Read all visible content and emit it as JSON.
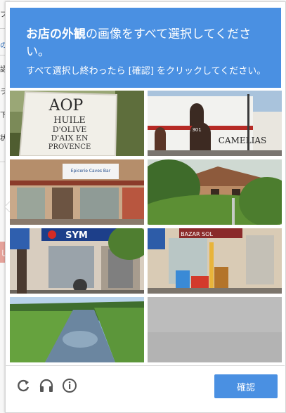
{
  "background_page": {
    "chars": [
      "フ",
      "の",
      "認",
      "ラ",
      "下",
      "状"
    ],
    "badge": "し"
  },
  "header": {
    "title_bold": "お店の外観",
    "title_rest": "の画像をすべて選択してください。",
    "subtitle": "すべて選択し終わったら [確認] をクリックしてください。"
  },
  "tiles": [
    {
      "name": "tile-aop-sign",
      "sign_line1": "AOP",
      "sign_line2": "HUILE",
      "sign_line3": "D'OLIVE",
      "sign_line4": "D'AIX EN",
      "sign_line5": "PROVENCE"
    },
    {
      "name": "tile-camelias-building",
      "sign": "CAMELIAS",
      "number": "301"
    },
    {
      "name": "tile-shop-banner",
      "sign": "Epicerie Caves Bar"
    },
    {
      "name": "tile-house-bushes"
    },
    {
      "name": "tile-sym-shop",
      "sign": "SYM"
    },
    {
      "name": "tile-bazar-shop",
      "sign": "BAZAR SOL"
    },
    {
      "name": "tile-river"
    },
    {
      "name": "tile-blank-road"
    }
  ],
  "footer": {
    "reload_icon": "reload-icon",
    "audio_icon": "headphones-icon",
    "info_icon": "info-icon",
    "verify_label": "確認"
  },
  "colors": {
    "accent": "#4a90e2"
  }
}
